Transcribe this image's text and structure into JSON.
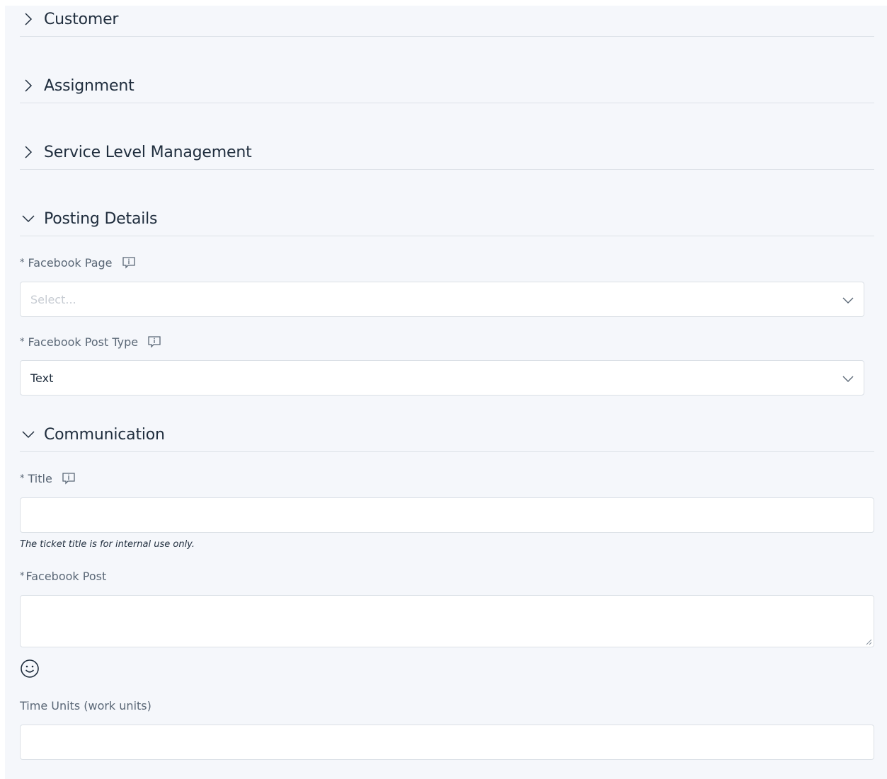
{
  "sections": {
    "customer": {
      "title": "Customer",
      "state": "collapsed",
      "icon": "chevron-right-icon"
    },
    "assignment": {
      "title": "Assignment",
      "state": "collapsed",
      "icon": "chevron-right-icon"
    },
    "service_level": {
      "title": "Service Level Management",
      "state": "collapsed",
      "icon": "chevron-right-icon"
    },
    "posting_details": {
      "title": "Posting Details",
      "state": "expanded",
      "icon": "chevron-down-icon"
    },
    "communication": {
      "title": "Communication",
      "state": "expanded",
      "icon": "chevron-down-icon"
    }
  },
  "posting_details": {
    "facebook_page": {
      "required_mark": "*",
      "label": "Facebook Page",
      "placeholder": "Select...",
      "value": "",
      "icon": "info-icon"
    },
    "facebook_post_type": {
      "required_mark": "*",
      "label": "Facebook Post Type",
      "value": "Text",
      "icon": "info-icon"
    }
  },
  "communication": {
    "title_field": {
      "required_mark": "*",
      "label": "Title",
      "value": "",
      "hint": "The ticket title is for internal use only.",
      "icon": "info-icon"
    },
    "facebook_post": {
      "required_mark": "*",
      "label": "Facebook Post",
      "value": ""
    },
    "emoji_icon": "smiley-icon",
    "time_units": {
      "label": "Time Units (work units)",
      "value": ""
    }
  },
  "colors": {
    "panel_background": "#f5f7fb",
    "text": "#1f2d3d",
    "label": "#5a6776",
    "border": "#dbe0e6",
    "placeholder": "#c7ccd3"
  }
}
